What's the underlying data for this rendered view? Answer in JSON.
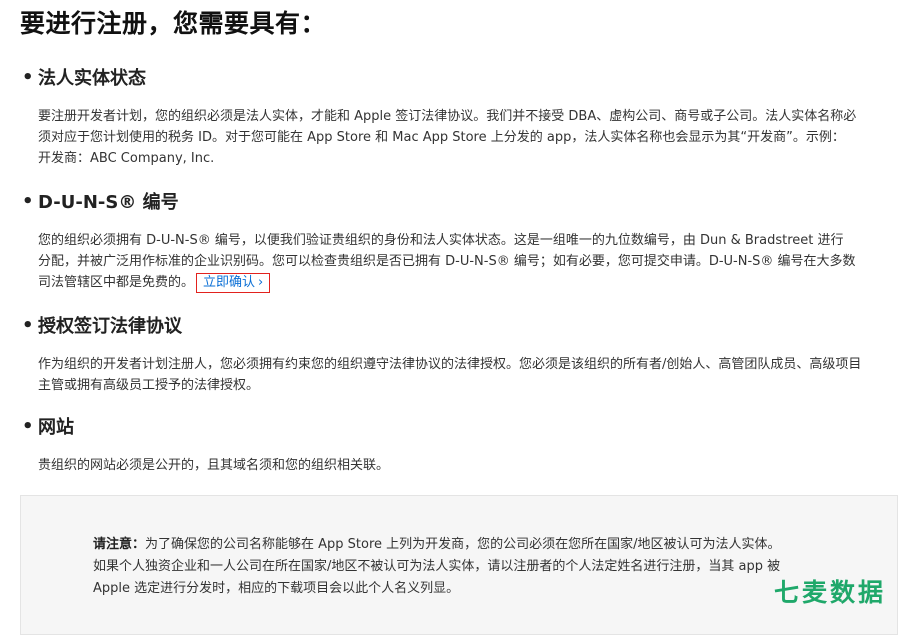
{
  "page": {
    "title": "要进行注册，您需要具有："
  },
  "sections": [
    {
      "bullet": "•",
      "title": "法人实体状态",
      "lines": [
        "要注册开发者计划，您的组织必须是法人实体，才能和 Apple 签订法律协议。我们并不接受 DBA、虚构公司、商号或子公司。法人实体名称必",
        "须对应于您计划使用的税务 ID。对于您可能在 App Store 和 Mac App Store 上分发的 app，法人实体名称也会显示为其“开发商”。示例：",
        "开发商：ABC Company, Inc."
      ]
    },
    {
      "bullet": "•",
      "title": "D-U-N-S® 编号",
      "lines": [
        "您的组织必须拥有 D-U-N-S® 编号，以便我们验证贵组织的身份和法人实体状态。这是一组唯一的九位数编号，由 Dun & Bradstreet 进行",
        "分配，并被广泛用作标准的企业识别码。您可以检查贵组织是否已拥有 D-U-N-S® 编号；如有必要，您可提交申请。D-U-N-S® 编号在大多数",
        "司法管辖区中都是免费的。"
      ],
      "link_label": "立即确认",
      "link_chevron": "›"
    },
    {
      "bullet": "•",
      "title": "授权签订法律协议",
      "lines": [
        "作为组织的开发者计划注册人，您必须拥有约束您的组织遵守法律协议的法律授权。您必须是该组织的所有者/创始人、高管团队成员、高级项目",
        "主管或拥有高级员工授予的法律授权。"
      ]
    },
    {
      "bullet": "•",
      "title": "网站",
      "lines": [
        "贵组织的网站必须是公开的，且其域名须和您的组织相关联。"
      ]
    }
  ],
  "note": {
    "label": "请注意：",
    "first_line": "为了确保您的公司名称能够在 App Store 上列为开发商，您的公司必须在您所在国家/地区被认可为法人实体。",
    "lines": [
      "如果个人独资企业和一人公司在所在国家/地区不被认可为法人实体，请以注册者的个人法定姓名进行注册，当其 app 被",
      "Apple 选定进行分发时，相应的下载项目会以此个人名义列显。"
    ]
  },
  "watermark": "七麦数据",
  "colors": {
    "link": "#0a6fd6",
    "highlight_border": "#e2221e",
    "watermark": "#1fa86a"
  }
}
